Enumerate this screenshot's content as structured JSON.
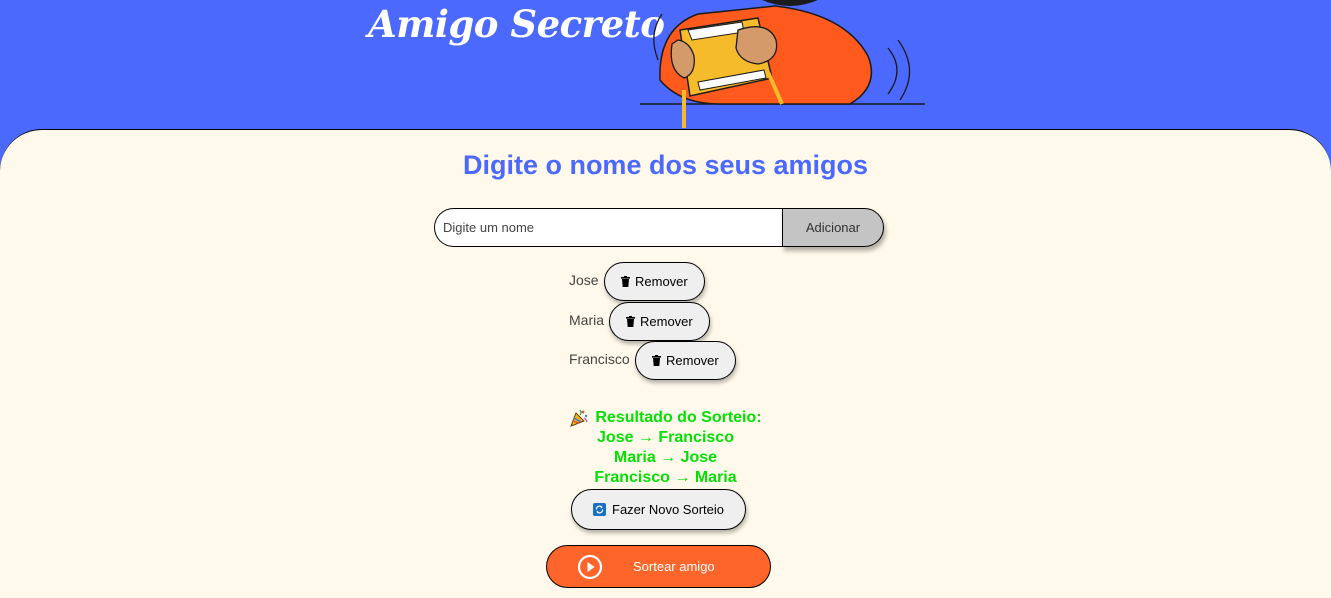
{
  "header": {
    "title": "Amigo Secreto"
  },
  "main": {
    "section_title": "Digite o nome dos seus amigos",
    "input_placeholder": "Digite um nome",
    "add_label": "Adicionar",
    "friends": [
      {
        "name": "Jose",
        "remove_label": "Remover"
      },
      {
        "name": "Maria",
        "remove_label": "Remover"
      },
      {
        "name": "Francisco",
        "remove_label": "Remover"
      }
    ],
    "result": {
      "heading": "Resultado do Sorteio:",
      "pairs": [
        "Jose → Francisco",
        "Maria → Jose",
        "Francisco → Maria"
      ]
    },
    "new_draw_label": "Fazer Novo Sorteio",
    "draw_label": "Sortear amigo"
  },
  "colors": {
    "header_background": "#4b69fd",
    "panel_background": "#fff9eb",
    "title_blue": "#4b69fd",
    "result_green": "#05df05",
    "draw_button_orange": "#fe652b",
    "add_button_gray": "#c4c4c4"
  },
  "icons": [
    "trash-icon",
    "party-popper-icon",
    "refresh-icon",
    "play-circle-icon"
  ]
}
